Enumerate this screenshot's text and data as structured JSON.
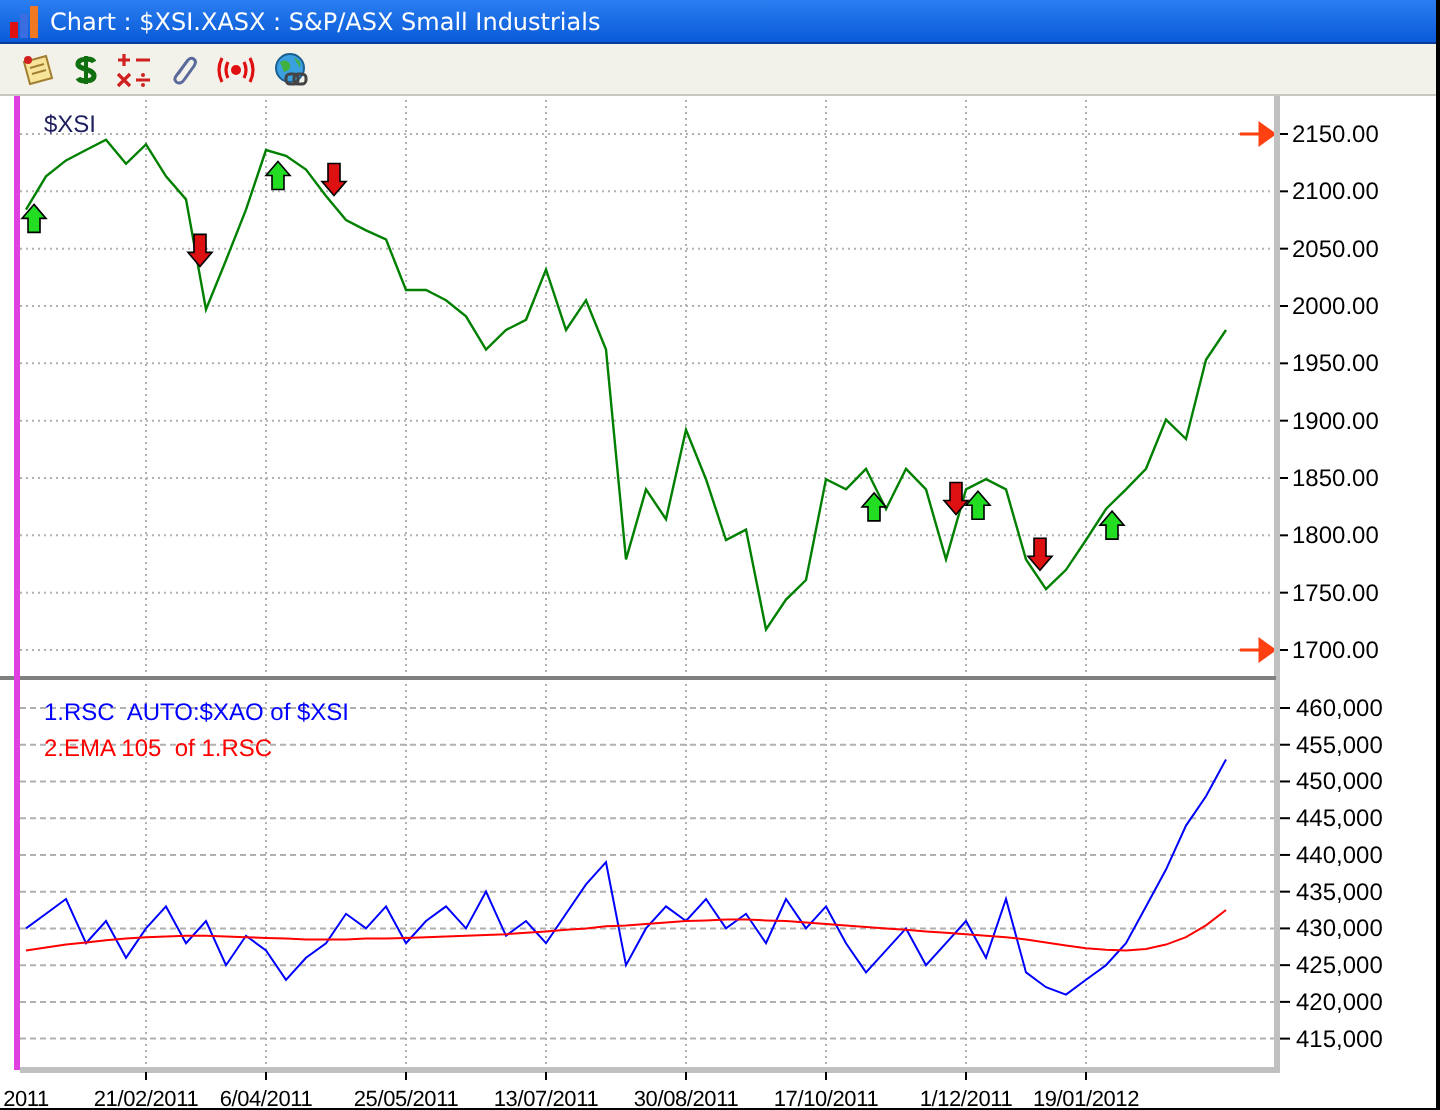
{
  "window": {
    "title": "Chart : $XSI.XASX : S&P/ASX Small Industrials"
  },
  "price_panel": {
    "chart_data": {
      "type": "line",
      "grid": true,
      "series": [
        {
          "name": "$XSI",
          "color": "#008000",
          "values": [
            2084,
            2113,
            2127,
            2136,
            2145,
            2124,
            2141,
            2113,
            2093,
            1997,
            2040,
            2084,
            2136,
            2131,
            2119,
            2096,
            2075,
            2066,
            2058,
            2014,
            2014,
            2005,
            1991,
            1962,
            1979,
            1988,
            2032,
            1979,
            2005,
            1962,
            1779,
            1840,
            1814,
            1892,
            1849,
            1796,
            1805,
            1718,
            1744,
            1761,
            1849,
            1840,
            1858,
            1823,
            1858,
            1840,
            1779,
            1840,
            1849,
            1840,
            1779,
            1753,
            1770,
            1796,
            1823,
            1840,
            1858,
            1901,
            1884,
            1953,
            1979
          ]
        }
      ],
      "ylim": [
        1700,
        2150
      ],
      "yticks": [
        {
          "value": 2150,
          "label": "2150.00"
        },
        {
          "value": 2100,
          "label": "2100.00"
        },
        {
          "value": 2050,
          "label": "2050.00"
        },
        {
          "value": 2000,
          "label": "2000.00"
        },
        {
          "value": 1950,
          "label": "1950.00"
        },
        {
          "value": 1900,
          "label": "1900.00"
        },
        {
          "value": 1850,
          "label": "1850.00"
        },
        {
          "value": 1800,
          "label": "1800.00"
        },
        {
          "value": 1750,
          "label": "1750.00"
        },
        {
          "value": 1700,
          "label": "1700.00"
        }
      ]
    }
  },
  "indicator_panel": {
    "chart_data": {
      "type": "line",
      "grid": true,
      "categories": [
        "2011",
        null,
        null,
        null,
        null,
        null,
        "21/02/2011",
        null,
        null,
        null,
        null,
        null,
        "6/04/2011",
        null,
        null,
        null,
        null,
        null,
        null,
        "25/05/2011",
        null,
        null,
        null,
        null,
        null,
        null,
        "13/07/2011",
        null,
        null,
        null,
        null,
        null,
        null,
        "30/08/2011",
        null,
        null,
        null,
        null,
        null,
        null,
        "17/10/2011",
        null,
        null,
        null,
        null,
        null,
        null,
        "1/12/2011",
        null,
        null,
        null,
        null,
        null,
        "19/01/2012",
        null,
        null,
        null,
        null,
        null,
        null,
        null
      ],
      "series": [
        {
          "name": "1.RSC  AUTO:$XAO of $XSI",
          "color": "#0000ff",
          "values": [
            430000,
            432000,
            434000,
            428000,
            431000,
            426000,
            430000,
            433000,
            428000,
            431000,
            425000,
            429000,
            427000,
            423000,
            426000,
            428000,
            432000,
            430000,
            433000,
            428000,
            431000,
            433000,
            430000,
            435000,
            429000,
            431000,
            428000,
            432000,
            436000,
            439000,
            425000,
            430000,
            433000,
            431000,
            434000,
            430000,
            432000,
            428000,
            434000,
            430000,
            433000,
            428000,
            424000,
            427000,
            430000,
            425000,
            428000,
            431000,
            426000,
            434000,
            424000,
            422000,
            421000,
            423000,
            425000,
            428000,
            433000,
            438000,
            444000,
            448000,
            453000
          ]
        },
        {
          "name": "2.EMA 105  of 1.RSC",
          "color": "#ff0000",
          "values": [
            427000,
            427400,
            427800,
            428100,
            428400,
            428600,
            428800,
            428900,
            429000,
            429000,
            428900,
            428800,
            428700,
            428600,
            428500,
            428500,
            428500,
            428600,
            428600,
            428700,
            428800,
            428900,
            429000,
            429100,
            429200,
            429400,
            429600,
            429800,
            430000,
            430300,
            430400,
            430600,
            430800,
            431000,
            431100,
            431200,
            431200,
            431100,
            431000,
            430800,
            430600,
            430400,
            430200,
            430000,
            429800,
            429600,
            429400,
            429200,
            429000,
            428800,
            428500,
            428100,
            427700,
            427300,
            427100,
            427000,
            427200,
            427800,
            428800,
            430400,
            432500
          ]
        }
      ],
      "ylim": [
        411000,
        460000
      ],
      "yticks": [
        {
          "value": 460000,
          "label": "460,000"
        },
        {
          "value": 455000,
          "label": "455,000"
        },
        {
          "value": 450000,
          "label": "450,000"
        },
        {
          "value": 445000,
          "label": "445,000"
        },
        {
          "value": 440000,
          "label": "440,000"
        },
        {
          "value": 435000,
          "label": "435,000"
        },
        {
          "value": 430000,
          "label": "430,000"
        },
        {
          "value": 425000,
          "label": "425,000"
        },
        {
          "value": 420000,
          "label": "420,000"
        },
        {
          "value": 415000,
          "label": "415,000"
        }
      ]
    }
  }
}
